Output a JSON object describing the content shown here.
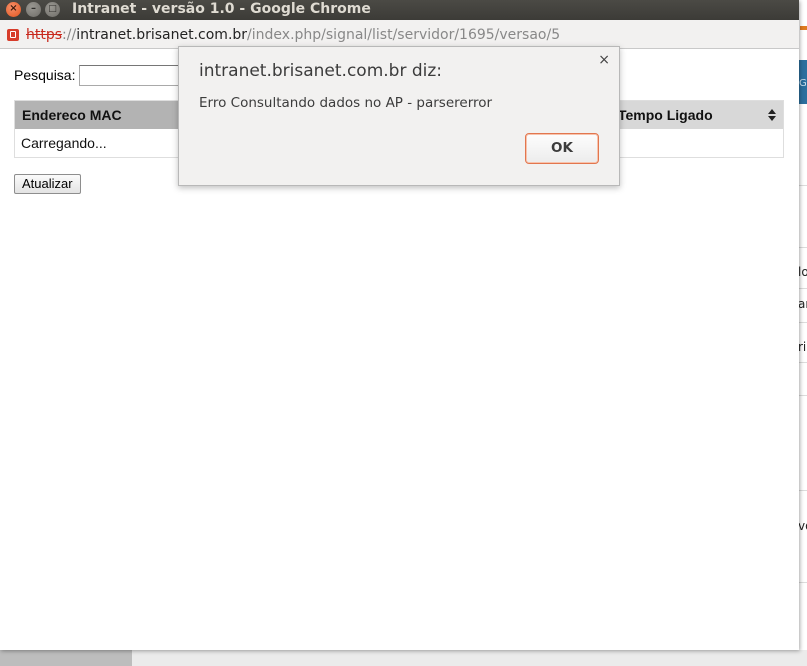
{
  "window": {
    "title": "Intranet - versão 1.0 - Google Chrome",
    "close_glyph": "×",
    "min_glyph": "–",
    "max_glyph": "□"
  },
  "address": {
    "scheme": "https",
    "separator": "://",
    "host": "intranet.brisanet.com.br",
    "path": "/index.php/signal/list/servidor/1695/versao/5"
  },
  "page": {
    "search_label": "Pesquisa:",
    "search_value": "",
    "table": {
      "headers": [
        "Endereco MAC",
        "Tempo Ligado"
      ],
      "loading_text": "Carregando..."
    },
    "refresh_label": "Atualizar"
  },
  "dialog": {
    "title": "intranet.brisanet.com.br diz:",
    "message": "Erro Consultando dados no AP - parsererror",
    "close_glyph": "×",
    "ok_label": "OK"
  },
  "background_window": {
    "fragments": [
      "lo",
      "ar",
      "ri",
      "vo"
    ],
    "banner_text": "G"
  }
}
